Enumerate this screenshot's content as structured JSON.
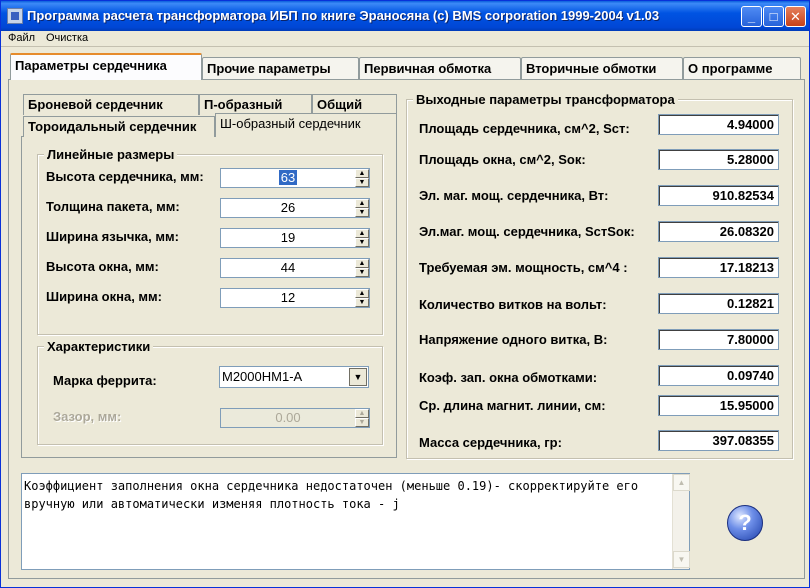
{
  "window": {
    "title": "Программа расчета трансформатора ИБП по книге Эраносяна      (c) BMS corporation 1999-2004  v1.03",
    "buttons": {
      "minimize": "_",
      "maximize": "□",
      "close": "✕"
    }
  },
  "menu": {
    "items": [
      "Файл",
      "Очистка"
    ]
  },
  "main_tabs": [
    "Параметры сердечника",
    "Прочие параметры",
    "Первичная обмотка",
    "Вторичные обмотки",
    "О программе"
  ],
  "sub_tabs": {
    "row_back": [
      "Броневой сердечник",
      "П-образный",
      "Общий"
    ],
    "row_front": [
      "Тороидальный сердечник",
      "Ш-образный сердечник"
    ]
  },
  "linear": {
    "title": "Линейные размеры",
    "fields": [
      {
        "label": "Высота сердечника, мм:",
        "value": "63"
      },
      {
        "label": "Толщина пакета, мм:",
        "value": "26"
      },
      {
        "label": "Ширина язычка, мм:",
        "value": "19"
      },
      {
        "label": "Высота окна, мм:",
        "value": "44"
      },
      {
        "label": "Ширина окна, мм:",
        "value": "12"
      }
    ]
  },
  "characteristics": {
    "title": "Характеристики",
    "ferrite_label": "Марка феррита:",
    "ferrite_value": "М2000НМ1-А",
    "gap_label": "Зазор, мм:",
    "gap_value": "0.00"
  },
  "output": {
    "title": "Выходные параметры трансформатора",
    "rows": [
      {
        "label": "Площадь сердечника, см^2, Sст:",
        "value": "4.94000"
      },
      {
        "label": "Площадь окна, см^2, Sок:",
        "value": "5.28000"
      },
      {
        "label": "Эл. маг. мощ. сердечника, Вт:",
        "value": "910.82534"
      },
      {
        "label": "Эл.маг. мощ. сердечника, SстSок:",
        "value": "26.08320"
      },
      {
        "label": "Требуемая эм. мощность, см^4 :",
        "value": "17.18213"
      },
      {
        "label": "Количество витков на вольт:",
        "value": "0.12821"
      },
      {
        "label": "Напряжение одного витка, В:",
        "value": "7.80000"
      },
      {
        "label": "Коэф. зап. окна обмотками:",
        "value": "0.09740"
      },
      {
        "label": "Ср. длина магнит. линии, см:",
        "value": "15.95000"
      },
      {
        "label": "Масса сердечника, гр:",
        "value": "397.08355"
      }
    ]
  },
  "message": "Коэффициент заполнения окна сердечника недостаточен (меньше 0.19)- скорректируйте его вручную или автоматически изменяя плотность тока - j",
  "help_button": "?"
}
